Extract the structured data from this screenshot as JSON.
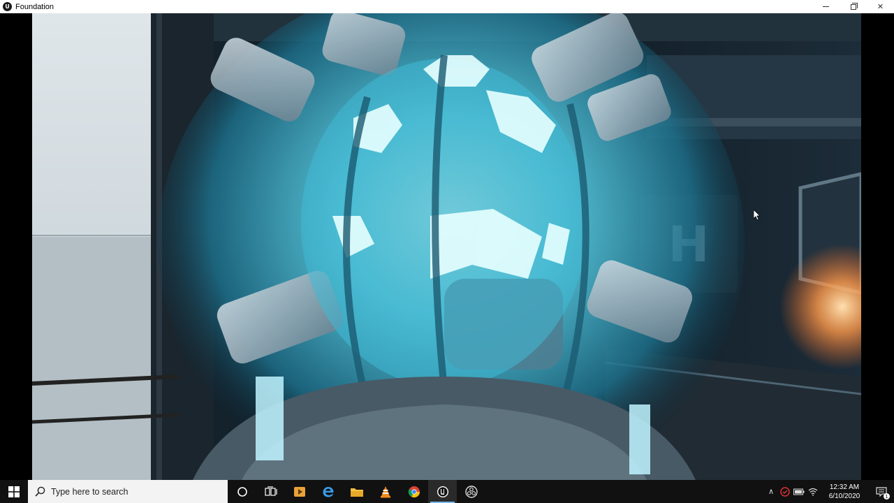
{
  "window": {
    "title": "Foundation",
    "app_icon_glyph": "U",
    "controls": {
      "close_glyph": "✕"
    }
  },
  "viewport": {
    "door_sign": "H"
  },
  "taskbar": {
    "search_placeholder": "Type here to search",
    "pinned": [
      {
        "name": "cortana-icon"
      },
      {
        "name": "task-view-icon"
      },
      {
        "name": "media-player-icon"
      },
      {
        "name": "edge-icon"
      },
      {
        "name": "file-explorer-icon"
      },
      {
        "name": "vlc-icon"
      },
      {
        "name": "chrome-icon"
      },
      {
        "name": "unreal-engine-icon",
        "active": true
      },
      {
        "name": "obs-icon"
      }
    ],
    "tray": {
      "chevron": "∧",
      "time": "12:32 AM",
      "date": "6/10/2020",
      "notification_count": "1"
    }
  },
  "colors": {
    "taskbar_bg": "#111111",
    "accent": "#76b9ed",
    "glow": "#6ff0ff"
  }
}
